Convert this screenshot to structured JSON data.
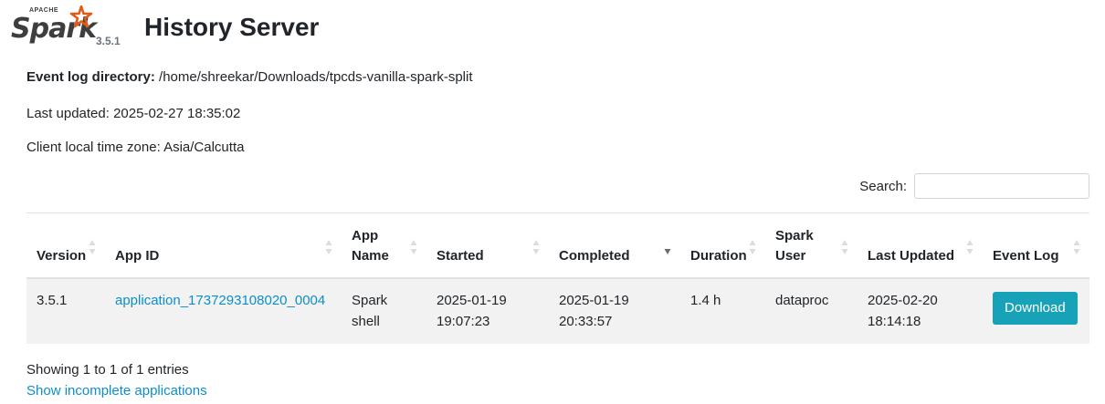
{
  "logo": {
    "apache": "APACHE",
    "spark": "Spark",
    "version": "3.5.1",
    "icon": "spark-star-icon"
  },
  "title": "History Server",
  "info": {
    "event_log_label": "Event log directory:",
    "event_log_value": "/home/shreekar/Downloads/tpcds-vanilla-spark-split",
    "last_updated": "Last updated: 2025-02-27 18:35:02",
    "timezone": "Client local time zone: Asia/Calcutta"
  },
  "search": {
    "label": "Search:",
    "value": ""
  },
  "table": {
    "headers": {
      "version": "Version",
      "app_id": "App ID",
      "app_name": "App Name",
      "started": "Started",
      "completed": "Completed",
      "duration": "Duration",
      "spark_user": "Spark User",
      "last_updated": "Last Updated",
      "event_log": "Event Log"
    },
    "rows": [
      {
        "version": "3.5.1",
        "app_id": "application_1737293108020_0004",
        "app_name": "Spark shell",
        "started": "2025-01-19 19:07:23",
        "completed": "2025-01-19 20:33:57",
        "duration": "1.4 h",
        "spark_user": "dataproc",
        "last_updated": "2025-02-20 18:14:18",
        "event_log_button": "Download"
      }
    ]
  },
  "footer": {
    "showing": "Showing 1 to 1 of 1 entries",
    "incomplete_link": "Show incomplete applications"
  },
  "colors": {
    "link": "#0d8ec9",
    "button": "#17a2b8",
    "row_bg": "#f2f2f2",
    "spark_orange": "#e25a1c"
  }
}
